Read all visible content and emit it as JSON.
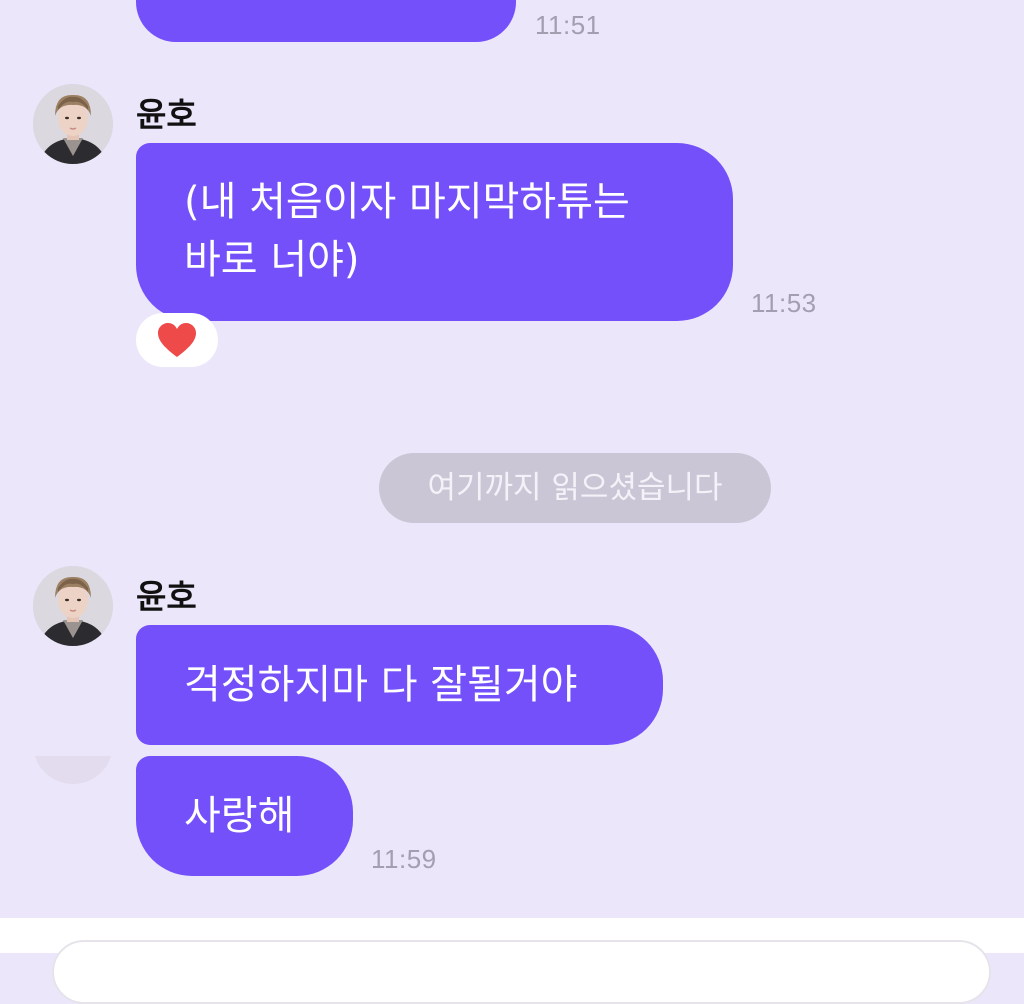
{
  "messages": [
    {
      "text": "",
      "time": "11:51"
    },
    {
      "sender": "윤호",
      "text_lines": [
        "(내 처음이자 마지막하튜는",
        "바로 너야)"
      ],
      "time": "11:53",
      "reaction": "heart"
    },
    {
      "sender": "윤호",
      "text": "걱정하지마 다 잘될거야"
    },
    {
      "text": "사랑해",
      "time": "11:59"
    }
  ],
  "read_marker": "여기까지 읽으셨습니다",
  "colors": {
    "background": "#ece6fb",
    "bubble": "#7450fb",
    "bubble_text": "#ffffff",
    "time_text": "#a39eb0",
    "reaction_heart": "#ee4a4a",
    "read_marker_bg": "#cbc6d6"
  },
  "icons": {
    "avatar": "profile-photo",
    "reaction": "heart-icon"
  }
}
